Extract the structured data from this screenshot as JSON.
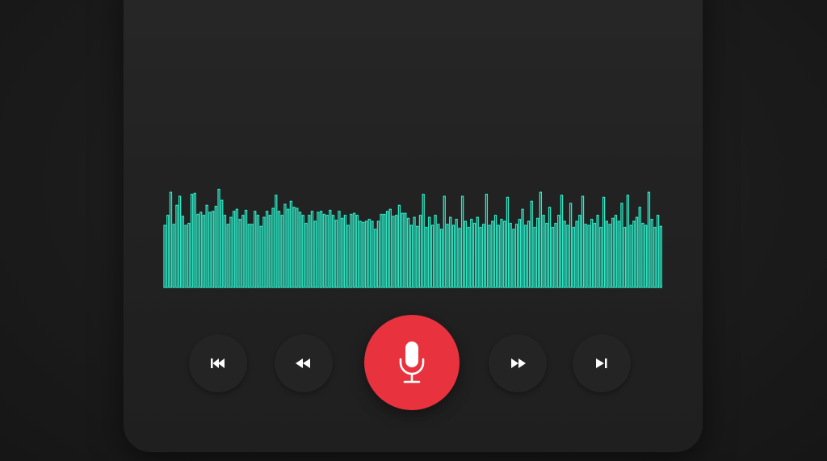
{
  "theme": {
    "background": "#1a1a1a",
    "panel": "#232323",
    "waveform_color": "#2ee6c4",
    "record_color": "#e8323d",
    "icon_color": "#ffffff"
  },
  "waveform": {
    "levels": [
      0.62,
      0.72,
      0.95,
      0.63,
      0.82,
      0.91,
      0.71,
      0.62,
      0.64,
      0.93,
      0.94,
      0.73,
      0.75,
      0.72,
      0.82,
      0.75,
      0.76,
      0.81,
      0.98,
      0.87,
      0.72,
      0.63,
      0.7,
      0.76,
      0.78,
      0.68,
      0.72,
      0.77,
      0.63,
      0.63,
      0.76,
      0.72,
      0.61,
      0.7,
      0.76,
      0.72,
      0.79,
      0.92,
      0.76,
      0.72,
      0.83,
      0.78,
      0.86,
      0.8,
      0.79,
      0.75,
      0.72,
      0.64,
      0.72,
      0.76,
      0.66,
      0.75,
      0.76,
      0.73,
      0.72,
      0.77,
      0.72,
      0.67,
      0.76,
      0.69,
      0.72,
      0.62,
      0.73,
      0.74,
      0.72,
      0.66,
      0.65,
      0.66,
      0.68,
      0.66,
      0.58,
      0.66,
      0.73,
      0.73,
      0.76,
      0.78,
      0.71,
      0.72,
      0.82,
      0.74,
      0.74,
      0.69,
      0.62,
      0.7,
      0.61,
      0.72,
      0.93,
      0.6,
      0.7,
      0.62,
      0.72,
      0.63,
      0.58,
      0.91,
      0.63,
      0.7,
      0.62,
      0.68,
      0.59,
      0.91,
      0.66,
      0.6,
      0.68,
      0.64,
      0.7,
      0.6,
      0.63,
      0.93,
      0.62,
      0.66,
      0.72,
      0.62,
      0.68,
      0.66,
      0.9,
      0.64,
      0.58,
      0.63,
      0.68,
      0.78,
      0.62,
      0.66,
      0.86,
      0.6,
      0.69,
      0.95,
      0.72,
      0.64,
      0.8,
      0.6,
      0.64,
      0.72,
      0.92,
      0.66,
      0.62,
      0.84,
      0.6,
      0.66,
      0.72,
      0.91,
      0.63,
      0.62,
      0.68,
      0.64,
      0.72,
      0.6,
      0.9,
      0.66,
      0.63,
      0.69,
      0.72,
      0.66,
      0.84,
      0.6,
      0.92,
      0.62,
      0.66,
      0.7,
      0.8,
      0.64,
      0.62,
      0.95,
      0.68,
      0.6,
      0.72,
      0.61
    ],
    "bar_style": "outline"
  },
  "controls": [
    {
      "name": "skip-back-button",
      "icon": "skip-to-start-icon"
    },
    {
      "name": "rewind-button",
      "icon": "rewind-icon"
    },
    {
      "name": "record-button",
      "icon": "microphone-icon"
    },
    {
      "name": "fast-forward-button",
      "icon": "fast-forward-icon"
    },
    {
      "name": "skip-forward-button",
      "icon": "skip-to-end-icon"
    }
  ]
}
